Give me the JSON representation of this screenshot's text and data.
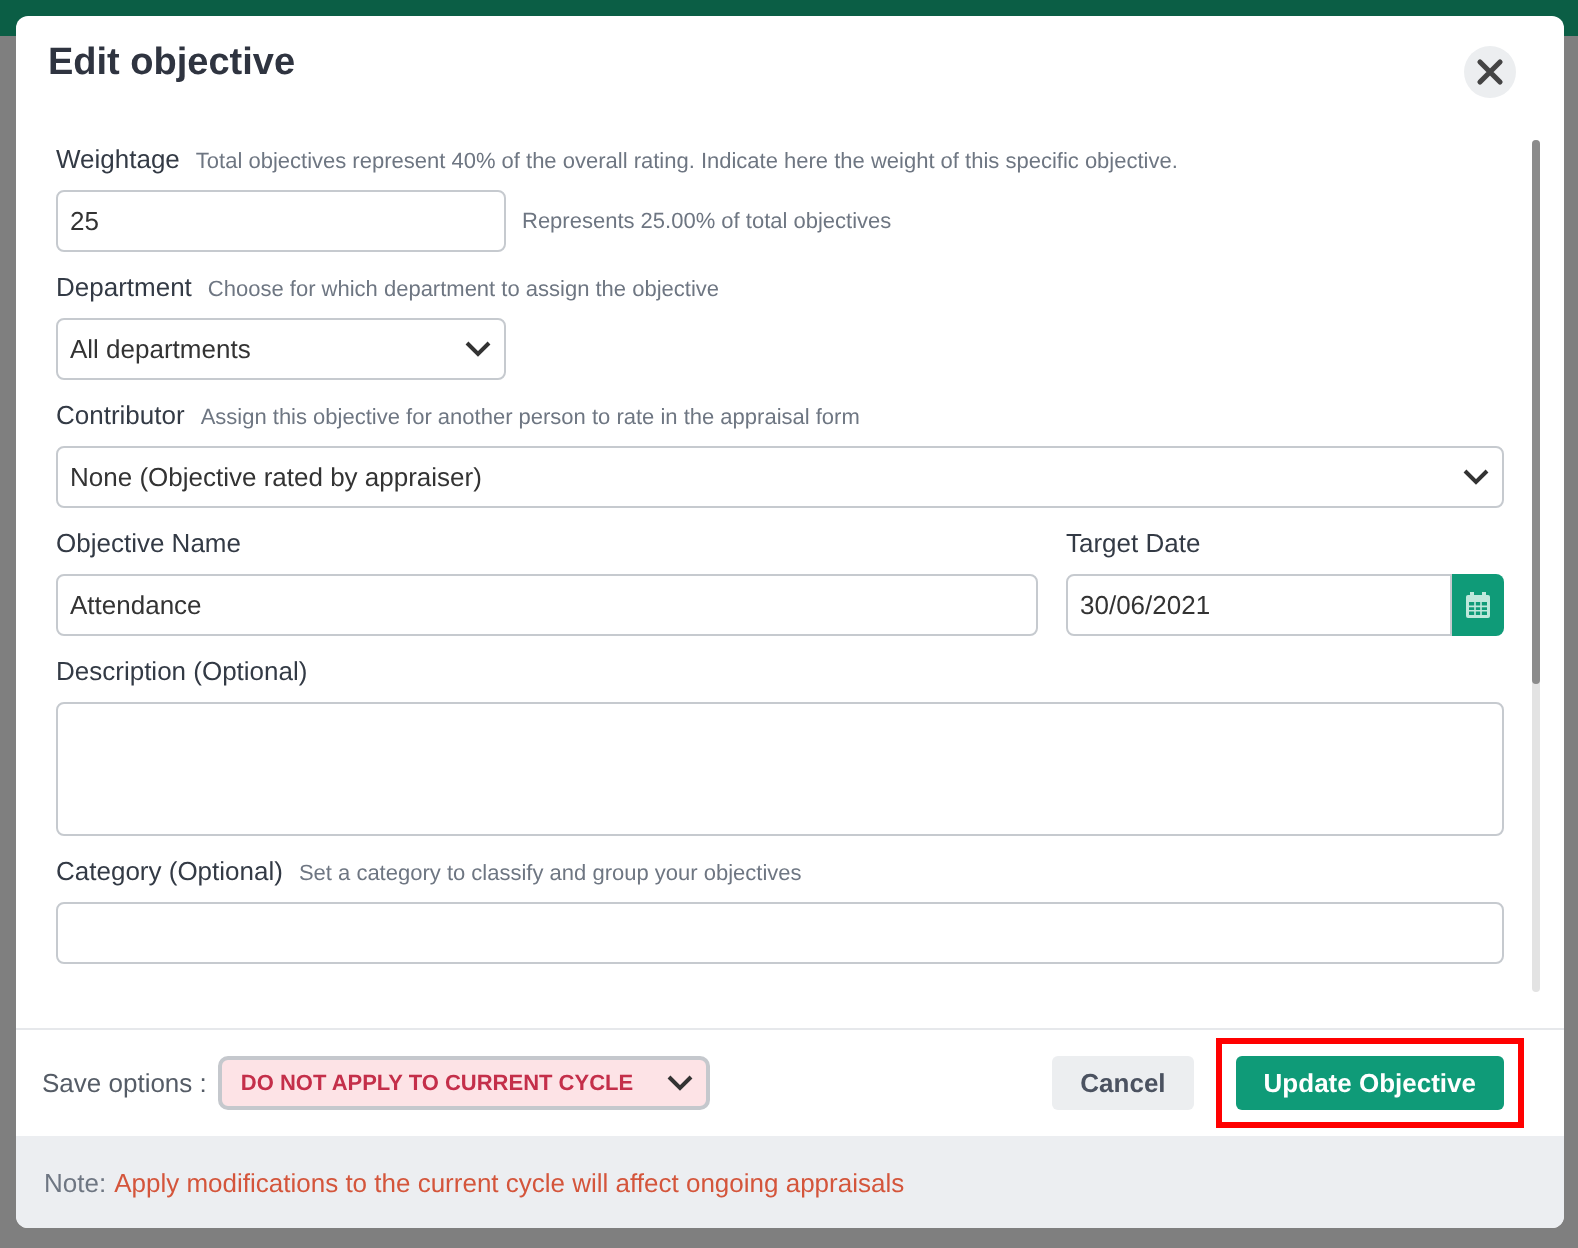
{
  "dialog": {
    "title": "Edit objective",
    "weightage": {
      "label": "Weightage",
      "hint": "Total objectives represent 40% of the overall rating. Indicate here the weight of this specific objective.",
      "value": "25",
      "note": "Represents 25.00% of total objectives"
    },
    "department": {
      "label": "Department",
      "hint": "Choose for which department to assign the objective",
      "value": "All departments"
    },
    "contributor": {
      "label": "Contributor",
      "hint": "Assign this objective for another person to rate in the appraisal form",
      "value": "None (Objective rated by appraiser)"
    },
    "objective_name": {
      "label": "Objective Name",
      "value": "Attendance"
    },
    "target_date": {
      "label": "Target Date",
      "value": "30/06/2021"
    },
    "description": {
      "label": "Description (Optional)"
    },
    "category": {
      "label": "Category (Optional)",
      "hint": "Set a category to classify and group your objectives"
    },
    "save_options": {
      "label": "Save options :",
      "value": "DO NOT APPLY TO CURRENT CYCLE"
    },
    "buttons": [
      {
        "kind": "secondary",
        "label": "Cancel",
        "highlighted": false
      },
      {
        "kind": "primary",
        "label": "Update Objective",
        "highlighted": true
      }
    ],
    "note": {
      "label": "Note:",
      "text": "Apply modifications to the current cycle will affect ongoing appraisals"
    }
  }
}
